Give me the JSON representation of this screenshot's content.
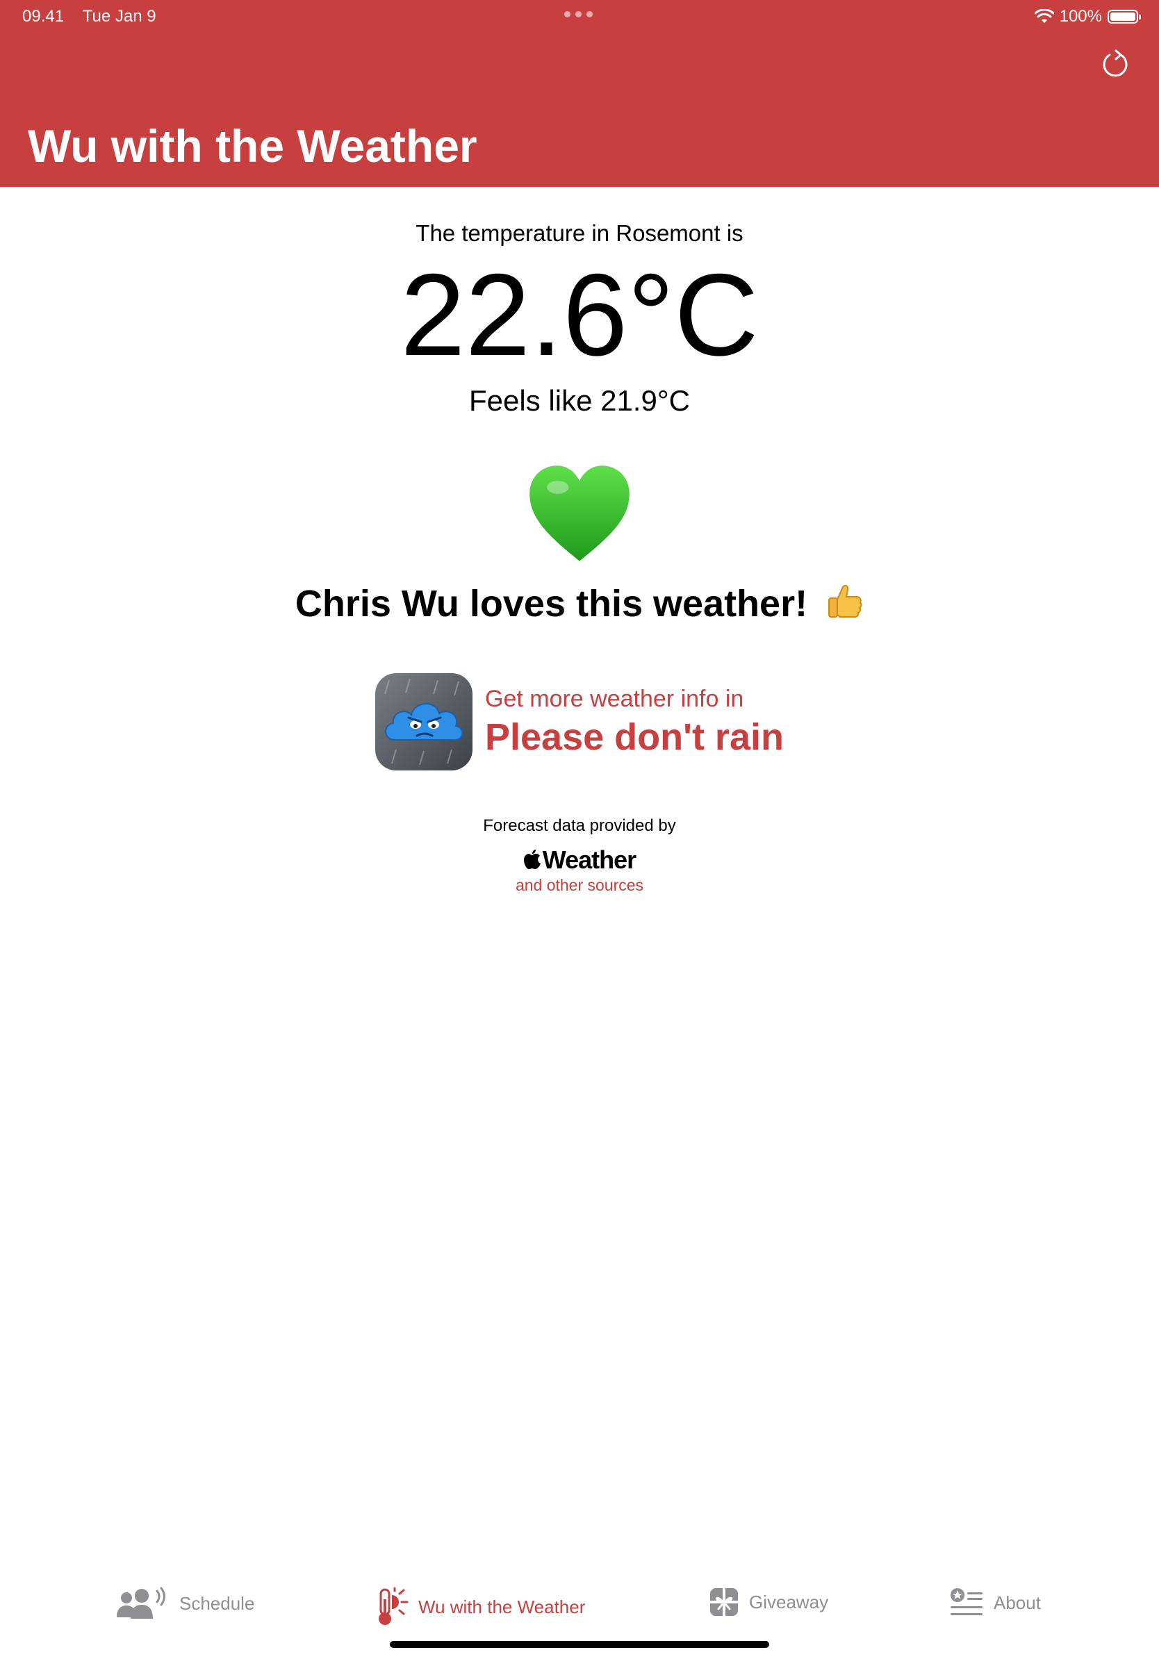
{
  "status_bar": {
    "time": "09.41",
    "date": "Tue Jan 9",
    "battery": "100%"
  },
  "header": {
    "title": "Wu with the Weather",
    "refresh_icon": "arrow-clockwise-icon",
    "background_color": "#c73f3f"
  },
  "weather": {
    "caption": "The temperature in Rosemont is",
    "temperature": "22.6°C",
    "feels_like": "Feels like 21.9°C",
    "status_icon": "green-heart-icon",
    "verdict": "Chris Wu loves this weather!",
    "verdict_icon": "thumbs-up-icon"
  },
  "promo": {
    "lead": "Get more weather info in",
    "app_name": "Please don't rain",
    "app_icon": "grumpy-rain-cloud-icon"
  },
  "attribution": {
    "caption": "Forecast data provided by",
    "brand": "Weather",
    "link": "and other sources"
  },
  "tabbar": {
    "accent_color": "#c73f3f",
    "inactive_color": "#8e8e93",
    "tabs": [
      {
        "label": "Schedule",
        "icon": "people-broadcast-icon",
        "active": false
      },
      {
        "label": "Wu with the Weather",
        "icon": "thermometer-sun-icon",
        "active": true
      },
      {
        "label": "Giveaway",
        "icon": "gift-icon",
        "active": false
      },
      {
        "label": "About",
        "icon": "list-star-icon",
        "active": false
      }
    ]
  }
}
